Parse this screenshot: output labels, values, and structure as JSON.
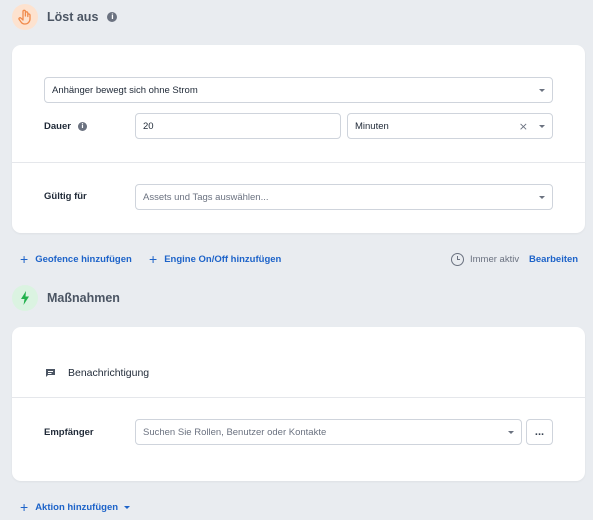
{
  "trigger": {
    "title": "Löst aus",
    "info_icon": "info-icon",
    "head_icon": "hand-icon",
    "event_select": {
      "value": "Anhänger bewegt sich ohne Strom"
    },
    "duration_label": "Dauer",
    "duration_value": "20",
    "duration_unit": "Minuten",
    "valid_label": "Gültig für",
    "valid_placeholder": "Assets und Tags auswählen..."
  },
  "links": {
    "add_geofence": "Geofence hinzufügen",
    "add_engine": "Engine On/Off hinzufügen",
    "schedule_status": "Immer aktiv",
    "edit": "Bearbeiten"
  },
  "actions": {
    "title": "Maßnahmen",
    "head_icon": "lightning-icon",
    "notification_label": "Benachrichtigung",
    "recipients_label": "Empfänger",
    "recipients_placeholder": "Suchen Sie Rollen, Benutzer oder Kontakte",
    "more_label": "...",
    "add_action": "Aktion hinzufügen"
  },
  "colors": {
    "background": "#e9ecf0",
    "link": "#1d63c9",
    "trigger_icon_bg": "#fde2cf",
    "action_icon_bg": "#dbf3e1",
    "action_icon": "#22b14c"
  }
}
